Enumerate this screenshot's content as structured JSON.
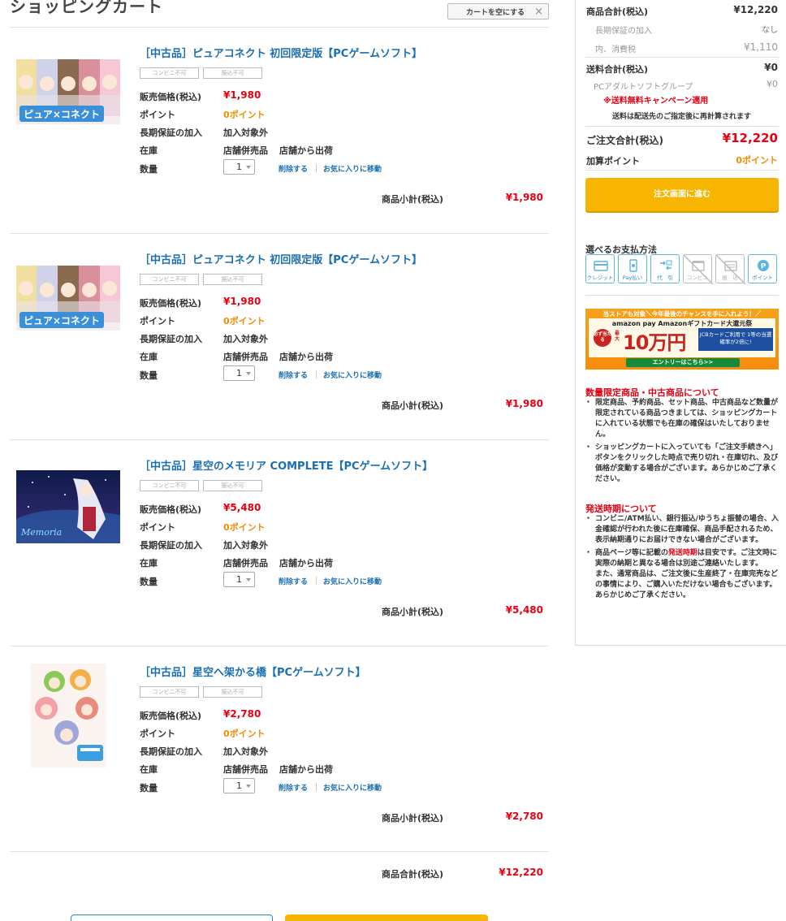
{
  "page": {
    "title": "ショッピングカート",
    "empty_cart_label": "カートを空にする",
    "close_symbol": "×"
  },
  "labels": {
    "conveni": "コンビニ不可",
    "furikomi": "振込不可",
    "price": "販売価格(税込)",
    "point": "ポイント",
    "warranty": "長期保証の加入",
    "stock": "在庫",
    "qty": "数量",
    "delete": "削除する",
    "favorite": "お気に入りに移動",
    "subtotal": "商品小計(税込)",
    "total": "商品合計(税込)"
  },
  "items": [
    {
      "title": "［中古品］ピュアコネクト 初回限定版【PCゲームソフト】",
      "price": "¥1,980",
      "point": "0ポイント",
      "warranty": "加入対象外",
      "stock": "店舗併売品",
      "ship": "店舗から出荷",
      "qty": "1",
      "subtotal": "¥1,980",
      "thumb": "pure-connect-cover"
    },
    {
      "title": "［中古品］ピュアコネクト 初回限定版【PCゲームソフト】",
      "price": "¥1,980",
      "point": "0ポイント",
      "warranty": "加入対象外",
      "stock": "店舗併売品",
      "ship": "店舗から出荷",
      "qty": "1",
      "subtotal": "¥1,980",
      "thumb": "pure-connect-cover"
    },
    {
      "title": "［中古品］星空のメモリア COMPLETE【PCゲームソフト】",
      "price": "¥5,480",
      "point": "0ポイント",
      "warranty": "加入対象外",
      "stock": "店舗併売品",
      "ship": "店舗から出荷",
      "qty": "1",
      "subtotal": "¥5,480",
      "thumb": "hoshizora-memoria-cover"
    },
    {
      "title": "［中古品］星空へ架かる橋【PCゲームソフト】",
      "price": "¥2,780",
      "point": "0ポイント",
      "warranty": "加入対象外",
      "stock": "店舗併売品",
      "ship": "店舗から出荷",
      "qty": "1",
      "subtotal": "¥2,780",
      "thumb": "hoshizora-kakeru-cover"
    }
  ],
  "cart_total": "¥12,220",
  "summary": {
    "goods_total_label": "商品合計(税込)",
    "goods_total": "¥12,220",
    "warranty_label": "長期保証の加入",
    "warranty_value": "なし",
    "tax_label": "内、消費税",
    "tax_value": "¥1,110",
    "shipping_label": "送料合計(税込)",
    "shipping_value": "¥0",
    "group_label": "PCアダルトソフトグループ",
    "group_value": "¥0",
    "campaign": "※送料無料キャンペーン適用",
    "recalc_note": "送料は配送先のご指定後に再計算されます",
    "order_total_label": "ご注文合計(税込)",
    "order_total": "¥12,220",
    "points_label": "加算ポイント",
    "points_value": "0ポイント",
    "proceed_label": "注文画面に進む"
  },
  "payment": {
    "heading": "選べるお支払方法",
    "methods": [
      {
        "label": "クレジット",
        "icon": "credit-card-icon",
        "enabled": true
      },
      {
        "label": "Pay払い",
        "icon": "smartphone-pay-icon",
        "enabled": true
      },
      {
        "label": "代　引",
        "icon": "cash-on-delivery-icon",
        "enabled": true
      },
      {
        "label": "コンビニ",
        "icon": "convenience-store-icon",
        "enabled": false
      },
      {
        "label": "振　込",
        "icon": "bank-transfer-icon",
        "enabled": false
      },
      {
        "label": "ポイント",
        "icon": "point-icon",
        "enabled": true
      }
    ]
  },
  "banner": {
    "top": "当ストアも対象＼今年最後のチャンスを手に入れよう！／",
    "amazon": "amazon pay  Amazonギフトカード大還元祭",
    "must": "必ず当たる",
    "saidai": "最大",
    "amount": "10万円",
    "jcb": "JCBカードご利用で 1等の当選確率が2倍に!",
    "entry": "エントリーはこちら>>"
  },
  "notes": {
    "limited_heading": "数量限定商品・中古商品について",
    "limited_items": [
      "限定商品、予約商品、セット商品、中古商品など数量が限定されている商品つきましては、ショッピングカートに入れている状態でも在庫の確保はいたしておりません。",
      "ショッピングカートに入っていても「ご注文手続きへ」ボタンをクリックした時点で売り切れ・在庫切れ、及び価格が変動する場合がございます。あらかじめご了承ください。"
    ],
    "shipping_heading": "発送時期について",
    "shipping_item1": "コンビニ/ATM払い、銀行振込/ゆうちょ振替の場合、入金確認が行われた後に在庫確保、商品手配されるため、表示納期通りにお届けできない場合がございます。",
    "shipping_item2_pre": "商品ページ等に記載の",
    "shipping_item2_link": "発送時期",
    "shipping_item2_post": "は目安です。ご注文時に実際の納期と異なる場合は別途ご連絡いたします。",
    "shipping_item3": "また、通常商品は、ご注文後に生産終了・在庫完売などの事情により、ご購入いただけない場合もございます。あらかじめご了承ください。"
  },
  "colors": {
    "link": "#1a6fb0",
    "price": "#e60012",
    "point": "#f08c00",
    "accent": "#f7b500"
  }
}
